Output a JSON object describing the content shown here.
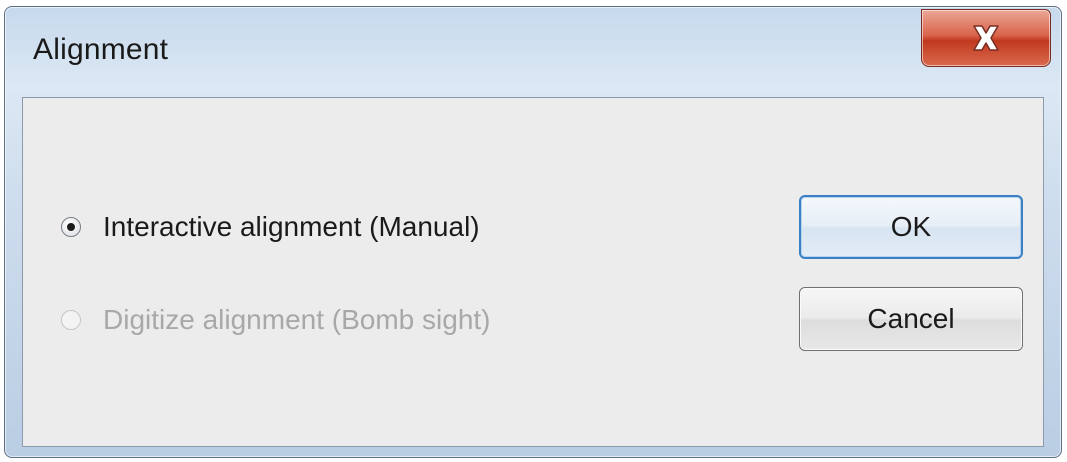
{
  "window": {
    "title": "Alignment",
    "close_icon": "close-x-icon"
  },
  "options": [
    {
      "label": "Interactive alignment (Manual)",
      "checked": true,
      "enabled": true
    },
    {
      "label": "Digitize alignment (Bomb sight)",
      "checked": false,
      "enabled": false
    }
  ],
  "buttons": {
    "ok_label": "OK",
    "cancel_label": "Cancel"
  },
  "colors": {
    "close_button": "#c0391f",
    "default_button_border": "#3b7fc4",
    "disabled_text": "#a8a8a8"
  }
}
